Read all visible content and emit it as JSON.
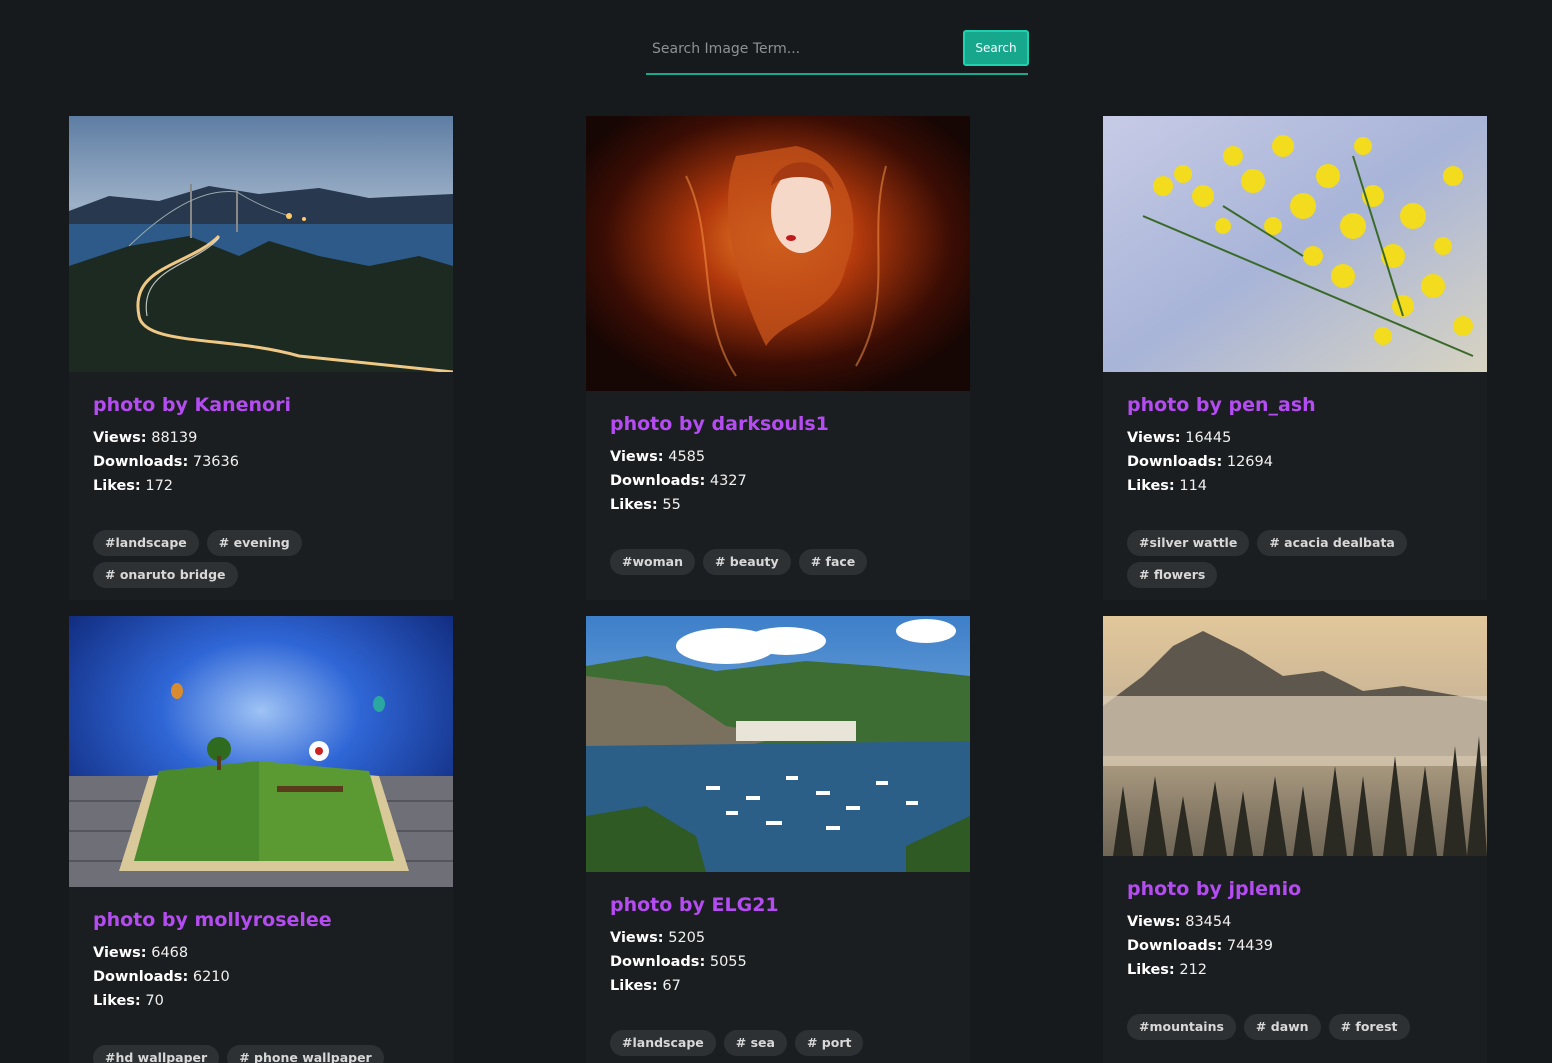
{
  "search": {
    "placeholder": "Search Image Term...",
    "button_label": "Search"
  },
  "labels": {
    "views": "Views:",
    "downloads": "Downloads:",
    "likes": "Likes:"
  },
  "cards": [
    {
      "author": "photo by Kanenori",
      "views": "88139",
      "downloads": "73636",
      "likes": "172",
      "tags": [
        "#landscape",
        "# evening",
        "# onaruto bridge"
      ]
    },
    {
      "author": "photo by darksouls1",
      "views": "4585",
      "downloads": "4327",
      "likes": "55",
      "tags": [
        "#woman",
        "# beauty",
        "# face"
      ]
    },
    {
      "author": "photo by pen_ash",
      "views": "16445",
      "downloads": "12694",
      "likes": "114",
      "tags": [
        "#silver wattle",
        "# acacia dealbata",
        "# flowers"
      ]
    },
    {
      "author": "photo by mollyroselee",
      "views": "6468",
      "downloads": "6210",
      "likes": "70",
      "tags": [
        "#hd wallpaper",
        "# phone wallpaper"
      ]
    },
    {
      "author": "photo by ELG21",
      "views": "5205",
      "downloads": "5055",
      "likes": "67",
      "tags": [
        "#landscape",
        "# sea",
        "# port"
      ]
    },
    {
      "author": "photo by jplenio",
      "views": "83454",
      "downloads": "74439",
      "likes": "212",
      "tags": [
        "#mountains",
        "# dawn",
        "# forest"
      ]
    }
  ]
}
